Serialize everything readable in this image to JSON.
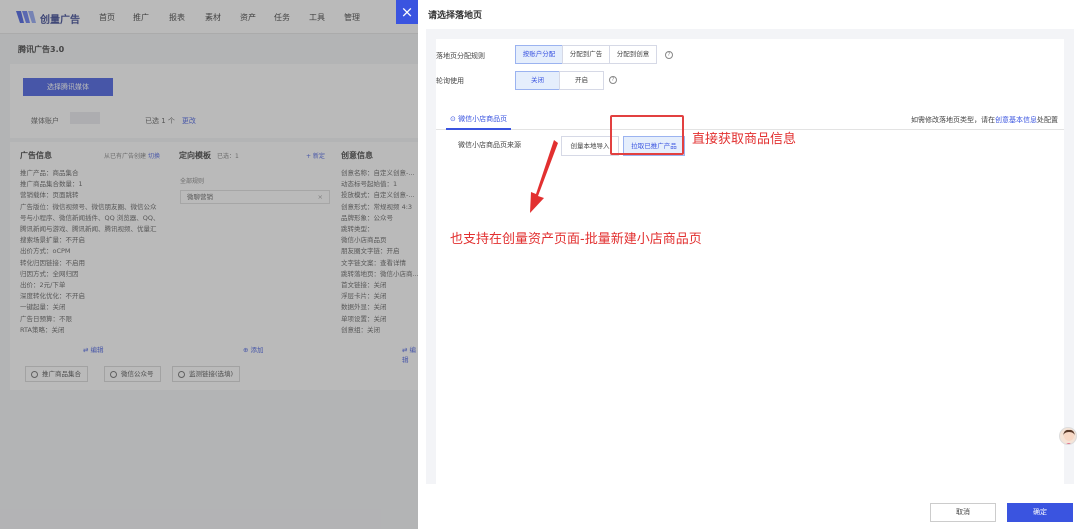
{
  "app": {
    "brand": "创量广告",
    "nav": [
      "首页",
      "推广",
      "报表",
      "素材",
      "资产",
      "任务",
      "工具",
      "管理"
    ],
    "crumb": "腾讯广告3.0",
    "select_media_btn": "选择腾讯媒体",
    "account_label": "媒体账户",
    "selected_count": "已选 1 个",
    "selected_action": "更改",
    "ad_info": {
      "title": "广告信息",
      "sub": "从已有广告创建",
      "switch": "切换",
      "lines": [
        "推广产品：商品集合",
        "推广商品集合数量：1",
        "营销载体：页面跳转",
        "广告版位：微信视频号、微信朋友圈、微信公众",
        "号与小程序、微信新闻插件、QQ 浏览器、QQ、",
        "腾讯新闻与游戏、腾讯新闻、腾讯视频、优量汇",
        "搜索场景扩量：不开启",
        "出价方式：oCPM",
        "转化归因链接：不启用",
        "归因方式：全网归因",
        "出价：2元/下单",
        "深度转化优化：不开启",
        "一键起量：关闭",
        "广告日预算：不限",
        "RTA策略：关闭"
      ],
      "edit": "编辑"
    },
    "target": {
      "title": "定向模板",
      "sub": "已选：1",
      "all_label": "全部规则",
      "select_value": "微聊营销",
      "add": "添加",
      "link": "+ 新定"
    },
    "creative": {
      "title": "创意信息",
      "lines": [
        "创意名称：自定义创意-...",
        "动态标号起始值：1",
        "投放模式：自定义创意-...",
        "创意形式：常规视频 4:3",
        "品牌形象：公众号",
        "跳转类型：",
        "微信小店商品页",
        "朋友圈文字链：开启",
        "文字链文案：查看详情",
        "跳转落地页：微信小店商...",
        "首文链接：关闭",
        "浮层卡片：关闭",
        "数据外显：关闭",
        "单项设置：关闭",
        "创意组：关闭"
      ],
      "edit": "编辑"
    },
    "footer_tags": [
      "推广商品集合",
      "微信公众号",
      "监测链接(选填)"
    ]
  },
  "drawer": {
    "close_icon": "×",
    "title": "请选择落地页",
    "rule_label": "落地页分配规则",
    "rule_options": [
      "按账户分配",
      "分配到广告",
      "分配到创意"
    ],
    "rotate_label": "轮询使用",
    "rotate_options": [
      "关闭",
      "开启"
    ],
    "tab": "微信小店商品页",
    "note_prefix": "如需修改落地页类型，请在",
    "note_link": "创意基本信息",
    "note_suffix": "处配置",
    "source_label": "微信小店商品页来源",
    "source_options": [
      "创量本地导入",
      "拉取已推广产品"
    ],
    "cancel": "取消",
    "confirm": "确定"
  },
  "annotations": {
    "right_text": "直接获取商品信息",
    "bottom_text": "也支持在创量资产页面-批量新建小店商品页",
    "color": "#e23030"
  },
  "icons": {
    "help": "?",
    "tab": "check-circle-icon"
  }
}
